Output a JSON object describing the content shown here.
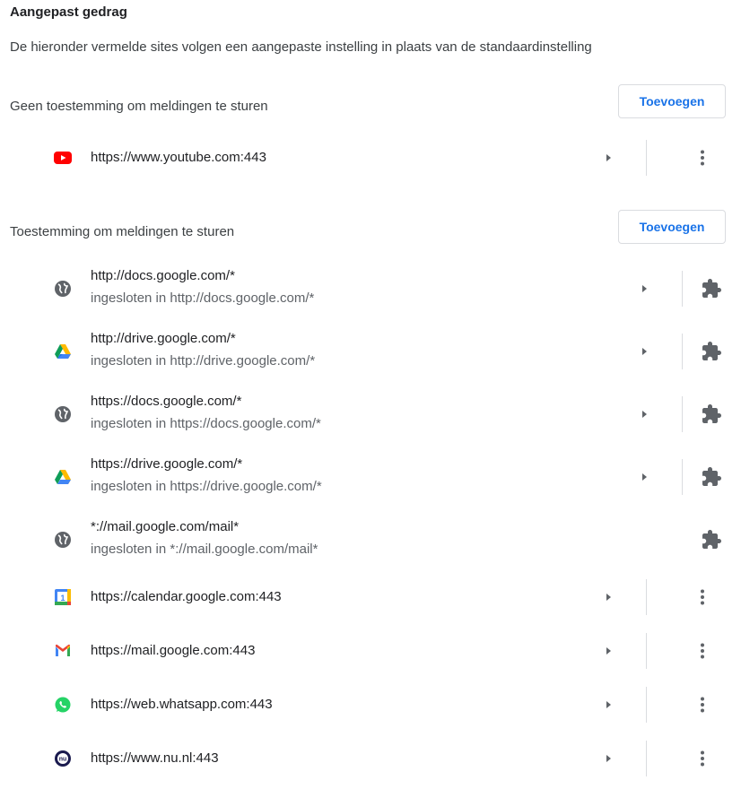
{
  "header": {
    "title": "Aangepast gedrag",
    "description": "De hieronder vermelde sites volgen een aangepaste instelling in plaats van de standaardinstelling"
  },
  "blocked": {
    "label": "Geen toestemming om meldingen te sturen",
    "add_label": "Toevoegen",
    "sites": [
      {
        "url": "https://www.youtube.com:443",
        "icon": "youtube-icon"
      }
    ]
  },
  "allowed": {
    "label": "Toestemming om meldingen te sturen",
    "add_label": "Toevoegen",
    "sites": [
      {
        "url": "http://docs.google.com/*",
        "sub": "ingesloten in http://docs.google.com/*",
        "icon": "globe-icon",
        "control": "extension-icon"
      },
      {
        "url": "http://drive.google.com/*",
        "sub": "ingesloten in http://drive.google.com/*",
        "icon": "google-drive-icon",
        "control": "extension-icon"
      },
      {
        "url": "https://docs.google.com/*",
        "sub": "ingesloten in https://docs.google.com/*",
        "icon": "globe-icon",
        "control": "extension-icon"
      },
      {
        "url": "https://drive.google.com/*",
        "sub": "ingesloten in https://drive.google.com/*",
        "icon": "google-drive-icon",
        "control": "extension-icon"
      },
      {
        "url": "*://mail.google.com/mail*",
        "sub": "ingesloten in *://mail.google.com/mail*",
        "icon": "globe-icon",
        "control": "extension-icon"
      },
      {
        "url": "https://calendar.google.com:443",
        "icon": "google-calendar-icon",
        "control": "more-icon"
      },
      {
        "url": "https://mail.google.com:443",
        "icon": "gmail-icon",
        "control": "more-icon"
      },
      {
        "url": "https://web.whatsapp.com:443",
        "icon": "whatsapp-icon",
        "control": "more-icon"
      },
      {
        "url": "https://www.nu.nl:443",
        "icon": "nu-nl-icon",
        "control": "more-icon"
      }
    ]
  },
  "colors": {
    "accent": "#1a73e8",
    "text": "#202124",
    "secondary_text": "#5f6368",
    "icon_gray": "#5f6368",
    "divider": "#dadce0"
  }
}
